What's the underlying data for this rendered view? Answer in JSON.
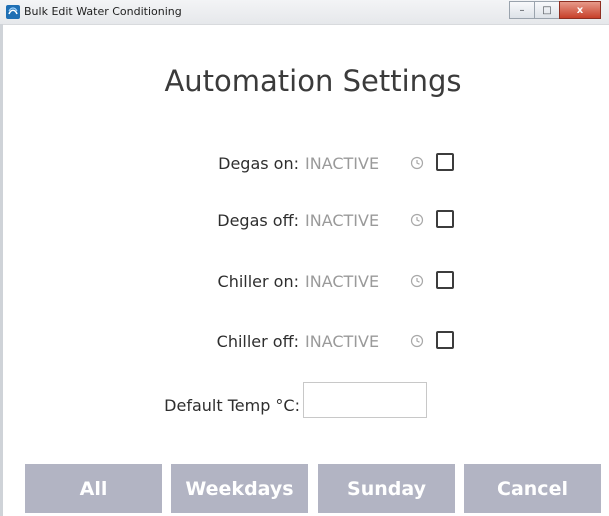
{
  "window": {
    "title": "Bulk Edit Water Conditioning",
    "controls": {
      "minimize": "–",
      "maximize": "□",
      "close": "x"
    }
  },
  "heading": "Automation Settings",
  "automation_rows": [
    {
      "label": "Degas on:",
      "status": "INACTIVE",
      "checked": false
    },
    {
      "label": "Degas off:",
      "status": "INACTIVE",
      "checked": false
    },
    {
      "label": "Chiller on:",
      "status": "INACTIVE",
      "checked": false
    },
    {
      "label": "Chiller off:",
      "status": "INACTIVE",
      "checked": false
    }
  ],
  "default_temp": {
    "label": "Default Temp °C:",
    "value": ""
  },
  "buttons": {
    "all": "All",
    "weekdays": "Weekdays",
    "sunday": "Sunday",
    "cancel": "Cancel"
  },
  "colors": {
    "button_bg": "#b2b4c3",
    "status_text": "#9a9a9a"
  }
}
